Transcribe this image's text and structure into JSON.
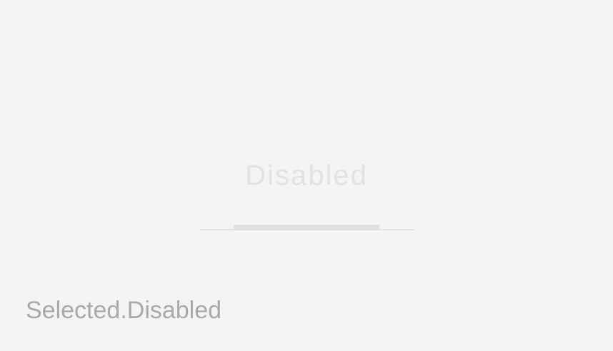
{
  "tab": {
    "label": "Disabled",
    "state": "selected-disabled"
  },
  "caption": {
    "text": "Selected.Disabled"
  },
  "colors": {
    "background": "#f4f4f4",
    "label_disabled": "#e2e2e2",
    "indicator": "#e0e0e0",
    "baseline": "#e4e4e4",
    "caption": "#a9a9a9"
  }
}
